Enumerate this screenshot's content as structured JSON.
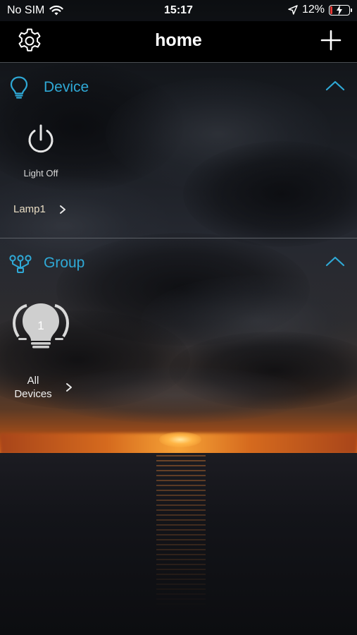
{
  "status_bar": {
    "carrier": "No SIM",
    "time": "15:17",
    "battery_percent": "12%",
    "battery_level": 0.12,
    "battery_color": "#e53935",
    "icons": [
      "wifi-icon",
      "location-arrow-icon",
      "battery-charging-icon"
    ]
  },
  "nav": {
    "title": "home",
    "left_icon": "gear-icon",
    "right_icon": "plus-icon"
  },
  "accent_color": "#2fa9d6",
  "sections": {
    "device": {
      "title": "Device",
      "icon": "lightbulb-outline-icon",
      "expanded": true,
      "items": [
        {
          "name": "Lamp1",
          "status": "Light Off",
          "icon": "power-icon"
        }
      ]
    },
    "group": {
      "title": "Group",
      "icon": "group-network-icon",
      "expanded": true,
      "items": [
        {
          "name": "All Devices",
          "count": "1",
          "icon": "triple-bulb-icon"
        }
      ]
    }
  }
}
